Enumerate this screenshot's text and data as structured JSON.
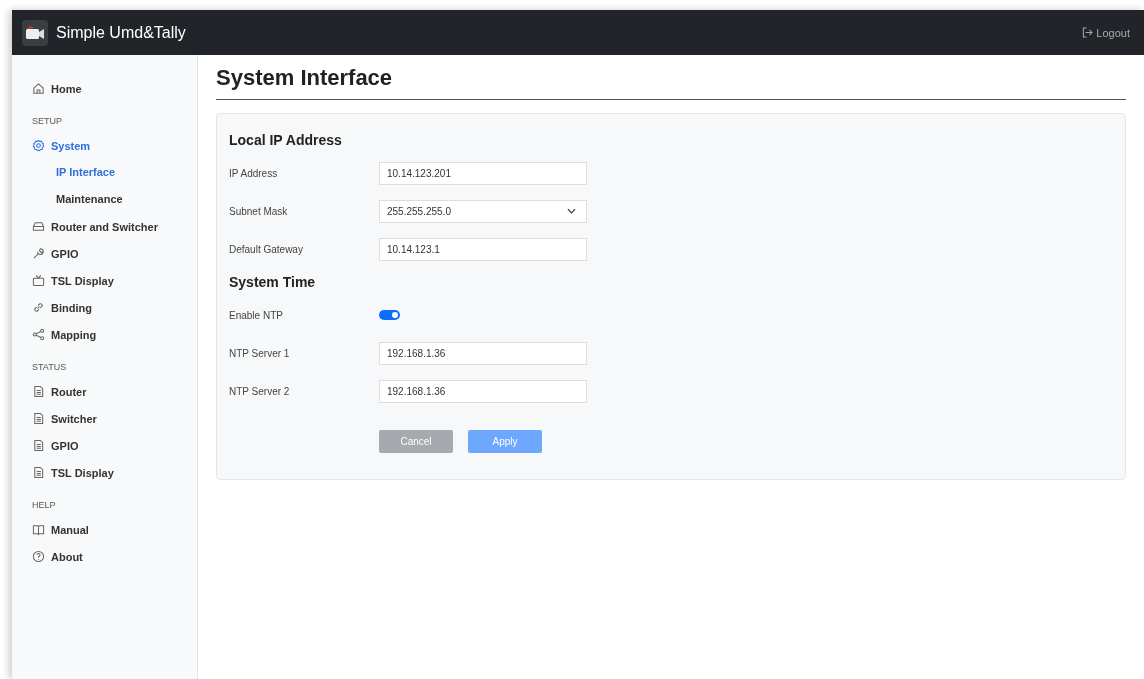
{
  "header": {
    "app_title": "Simple Umd&Tally",
    "logout": "Logout"
  },
  "sidebar": {
    "sections": [
      {
        "items": [
          {
            "label": "Home",
            "kind": "home",
            "selected": false
          }
        ]
      },
      {
        "title": "SETUP",
        "items": [
          {
            "label": "System",
            "kind": "gear",
            "selected": true,
            "children": [
              {
                "label": "IP Interface",
                "selected": true
              },
              {
                "label": "Maintenance",
                "selected": false
              }
            ]
          },
          {
            "label": "Router and Switcher",
            "kind": "drive",
            "selected": false
          },
          {
            "label": "GPIO",
            "kind": "wrench",
            "selected": false
          },
          {
            "label": "TSL Display",
            "kind": "tv",
            "selected": false
          },
          {
            "label": "Binding",
            "kind": "link",
            "selected": false
          },
          {
            "label": "Mapping",
            "kind": "share",
            "selected": false
          }
        ]
      },
      {
        "title": "STATUS",
        "items": [
          {
            "label": "Router",
            "kind": "file",
            "selected": false
          },
          {
            "label": "Switcher",
            "kind": "file",
            "selected": false
          },
          {
            "label": "GPIO",
            "kind": "file",
            "selected": false
          },
          {
            "label": "TSL Display",
            "kind": "file",
            "selected": false
          }
        ]
      },
      {
        "title": "HELP",
        "items": [
          {
            "label": "Manual",
            "kind": "book",
            "selected": false
          },
          {
            "label": "About",
            "kind": "help",
            "selected": false
          }
        ]
      }
    ]
  },
  "page_title": "System Interface",
  "form": {
    "groups": [
      {
        "title": "Local IP Address",
        "rows": [
          {
            "label": "IP Address",
            "kind": "text",
            "value": "10.14.123.201"
          },
          {
            "label": "Subnet Mask",
            "kind": "select",
            "value": "255.255.255.0"
          },
          {
            "label": "Default Gateway",
            "kind": "text",
            "value": "10.14.123.1"
          }
        ]
      },
      {
        "title": "System Time",
        "rows": [
          {
            "label": "Enable NTP",
            "kind": "toggle",
            "on": true
          },
          {
            "label": "NTP Server 1",
            "kind": "text",
            "value": "192.168.1.36"
          },
          {
            "label": "NTP Server 2",
            "kind": "text",
            "value": "192.168.1.36"
          }
        ]
      }
    ],
    "buttons": [
      {
        "label": "Cancel",
        "kind": "cancel"
      },
      {
        "label": "Apply",
        "kind": "primary"
      }
    ]
  }
}
